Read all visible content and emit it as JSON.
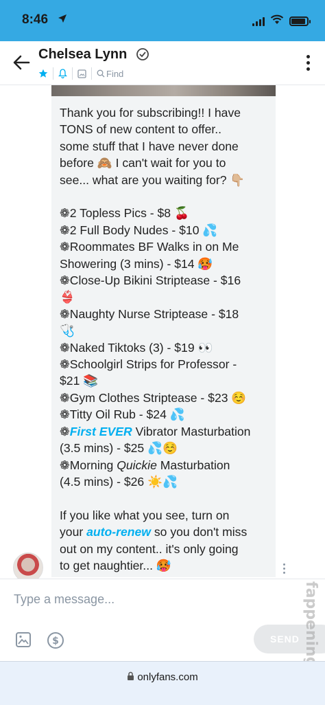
{
  "status_bar": {
    "time": "8:46",
    "location_icon": "location-arrow-icon",
    "signal_icon": "cellular-signal-icon",
    "wifi_icon": "wifi-icon",
    "battery_icon": "battery-icon"
  },
  "header": {
    "back_icon": "back-arrow-icon",
    "name": "Chelsea Lynn",
    "verified_icon": "verified-badge-icon",
    "tools": {
      "star_icon": "star-icon",
      "bell_icon": "bell-icon",
      "image_icon": "image-icon",
      "find_label": "Find"
    },
    "more_icon": "more-vertical-icon"
  },
  "message": {
    "lines": [
      "Thank you for subscribing!! I have",
      "TONS of new content to offer..",
      "some stuff that I have never done",
      "before 🙈 I can't wait for you to",
      "see... what are you waiting for? 👇🏼"
    ],
    "items": [
      {
        "bullet": "❁",
        "text": "2 Topless Pics - $8 🍒"
      },
      {
        "bullet": "❁",
        "text": "2 Full Body Nudes - $10 💦"
      },
      {
        "bullet": "❁",
        "text": "Roommates BF Walks in on Me"
      },
      {
        "bullet": "",
        "text": "Showering (3 mins) - $14 🥵"
      },
      {
        "bullet": "❁",
        "text": "Close-Up Bikini Striptease - $16"
      },
      {
        "bullet": "",
        "text": "👙"
      },
      {
        "bullet": "❁",
        "text": "Naughty Nurse Striptease - $18"
      },
      {
        "bullet": "",
        "text": "🩺"
      },
      {
        "bullet": "❁",
        "text": "Naked Tiktoks (3) - $19 👀"
      },
      {
        "bullet": "❁",
        "text": "Schoolgirl Strips for Professor -"
      },
      {
        "bullet": "",
        "text": "$21 📚"
      },
      {
        "bullet": "❁",
        "text": "Gym Clothes Striptease - $23 ☺️"
      },
      {
        "bullet": "❁",
        "text": "Titty Oil Rub - $24 💦"
      }
    ],
    "vibrator_item": {
      "bullet": "❁",
      "accent": "First EVER",
      "rest": " Vibrator Masturbation",
      "line2": "(3.5 mins) - $25 💦☺️"
    },
    "quickie_item": {
      "bullet": "❁",
      "pre": "Morning ",
      "italic": "Quickie",
      "rest": " Masturbation",
      "line2": "(4.5 mins) - $26 ☀️💦"
    },
    "closing": {
      "line1": "If you like what you see, turn on",
      "pre2": "your ",
      "accent2": "auto-renew",
      "rest2": " so you don't miss",
      "line3": "out on my content.. it's only going",
      "line4": "to get naughtier... 🥵"
    }
  },
  "composer": {
    "placeholder": "Type a message...",
    "media_icon": "image-attach-icon",
    "tip_icon": "dollar-tip-icon",
    "send_label": "SEND"
  },
  "watermark": "fappeningbook.com",
  "address_bar": {
    "url": "onlyfans.com",
    "lock_icon": "lock-icon"
  },
  "colors": {
    "status_bar": "#35a9e3",
    "accent": "#00aff0",
    "bubble": "#f2f4f5",
    "muted": "#8a96a3"
  }
}
